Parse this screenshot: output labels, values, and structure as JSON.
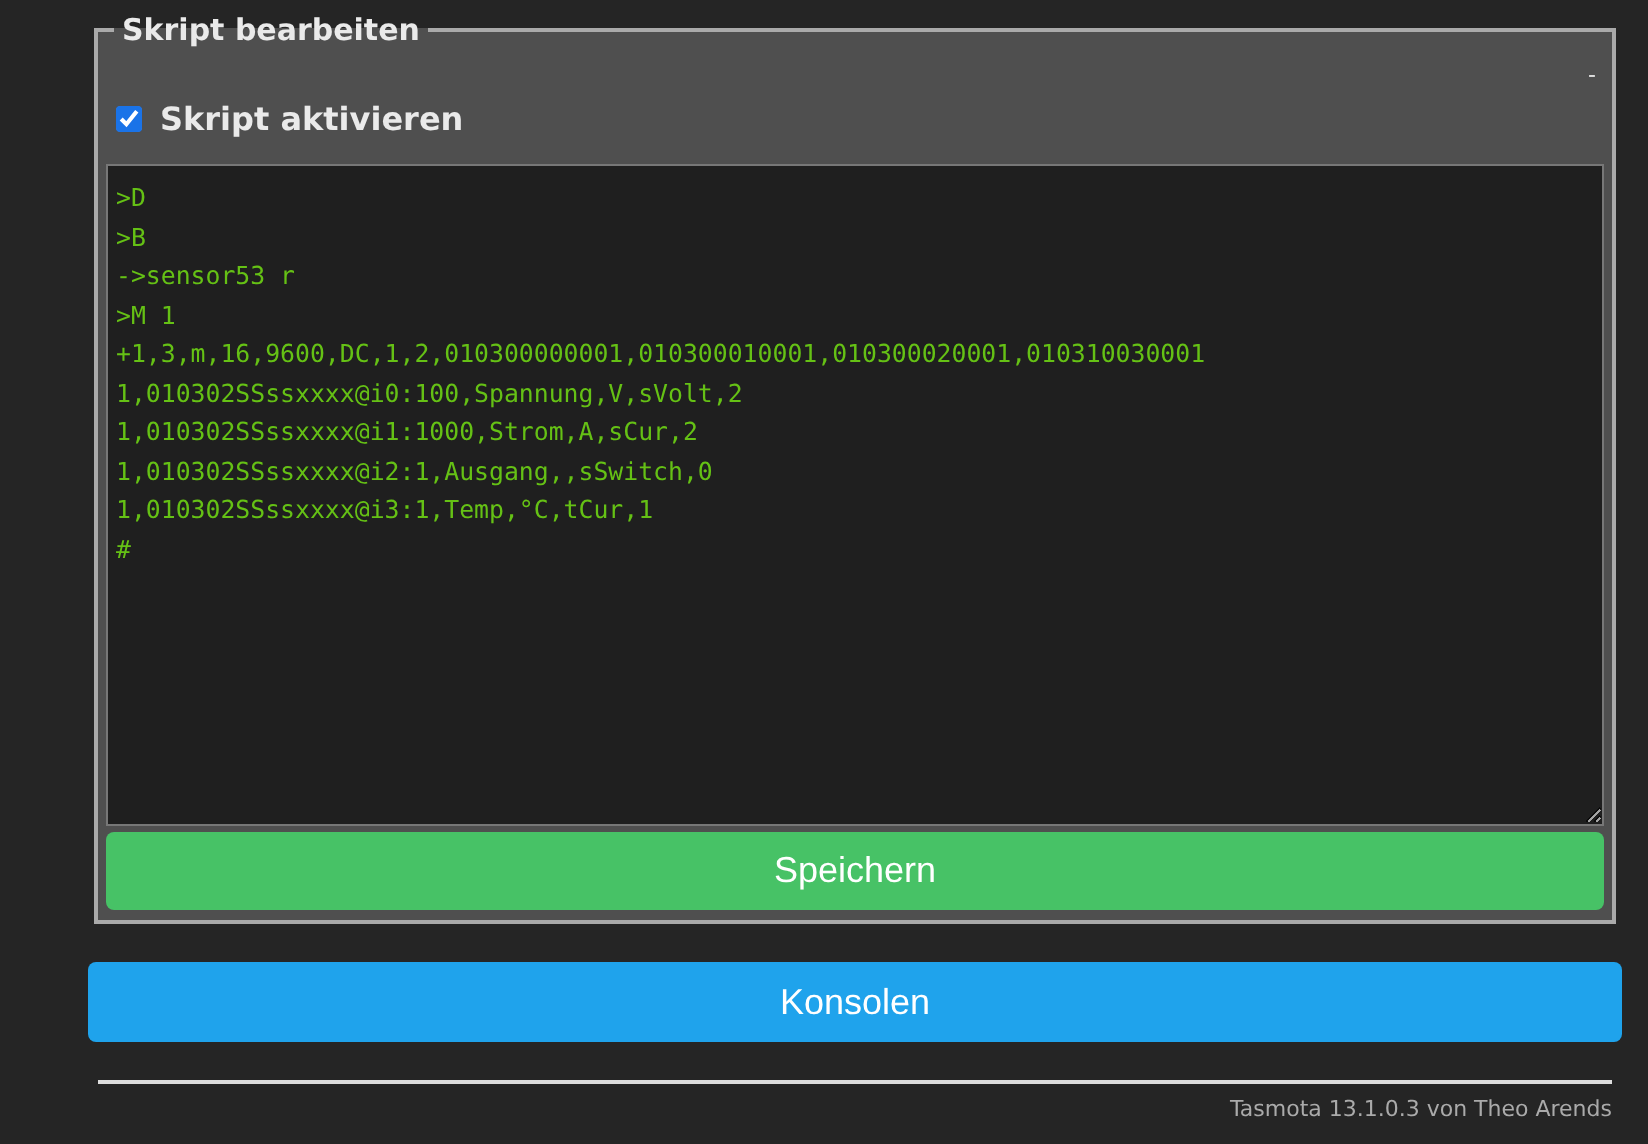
{
  "fieldset": {
    "legend": "Skript bearbeiten",
    "corner_mark": "-",
    "enable_checkbox": {
      "label": "Skript aktivieren",
      "checked": true
    },
    "script_lines": [
      ">D",
      ">B",
      "->sensor53 r",
      ">M 1",
      "+1,3,m,16,9600,DC,1,2,010300000001,010300010001,010300020001,010310030001",
      "1,010302SSssxxxx@i0:100,Spannung,V,sVolt,2",
      "1,010302SSssxxxx@i1:1000,Strom,A,sCur,2",
      "1,010302SSssxxxx@i2:1,Ausgang,,sSwitch,0",
      "1,010302SSssxxxx@i3:1,Temp,°C,tCur,1",
      "#"
    ],
    "save_button": "Speichern"
  },
  "console_button": "Konsolen",
  "footer": "Tasmota 13.1.0.3 von Theo Arends"
}
